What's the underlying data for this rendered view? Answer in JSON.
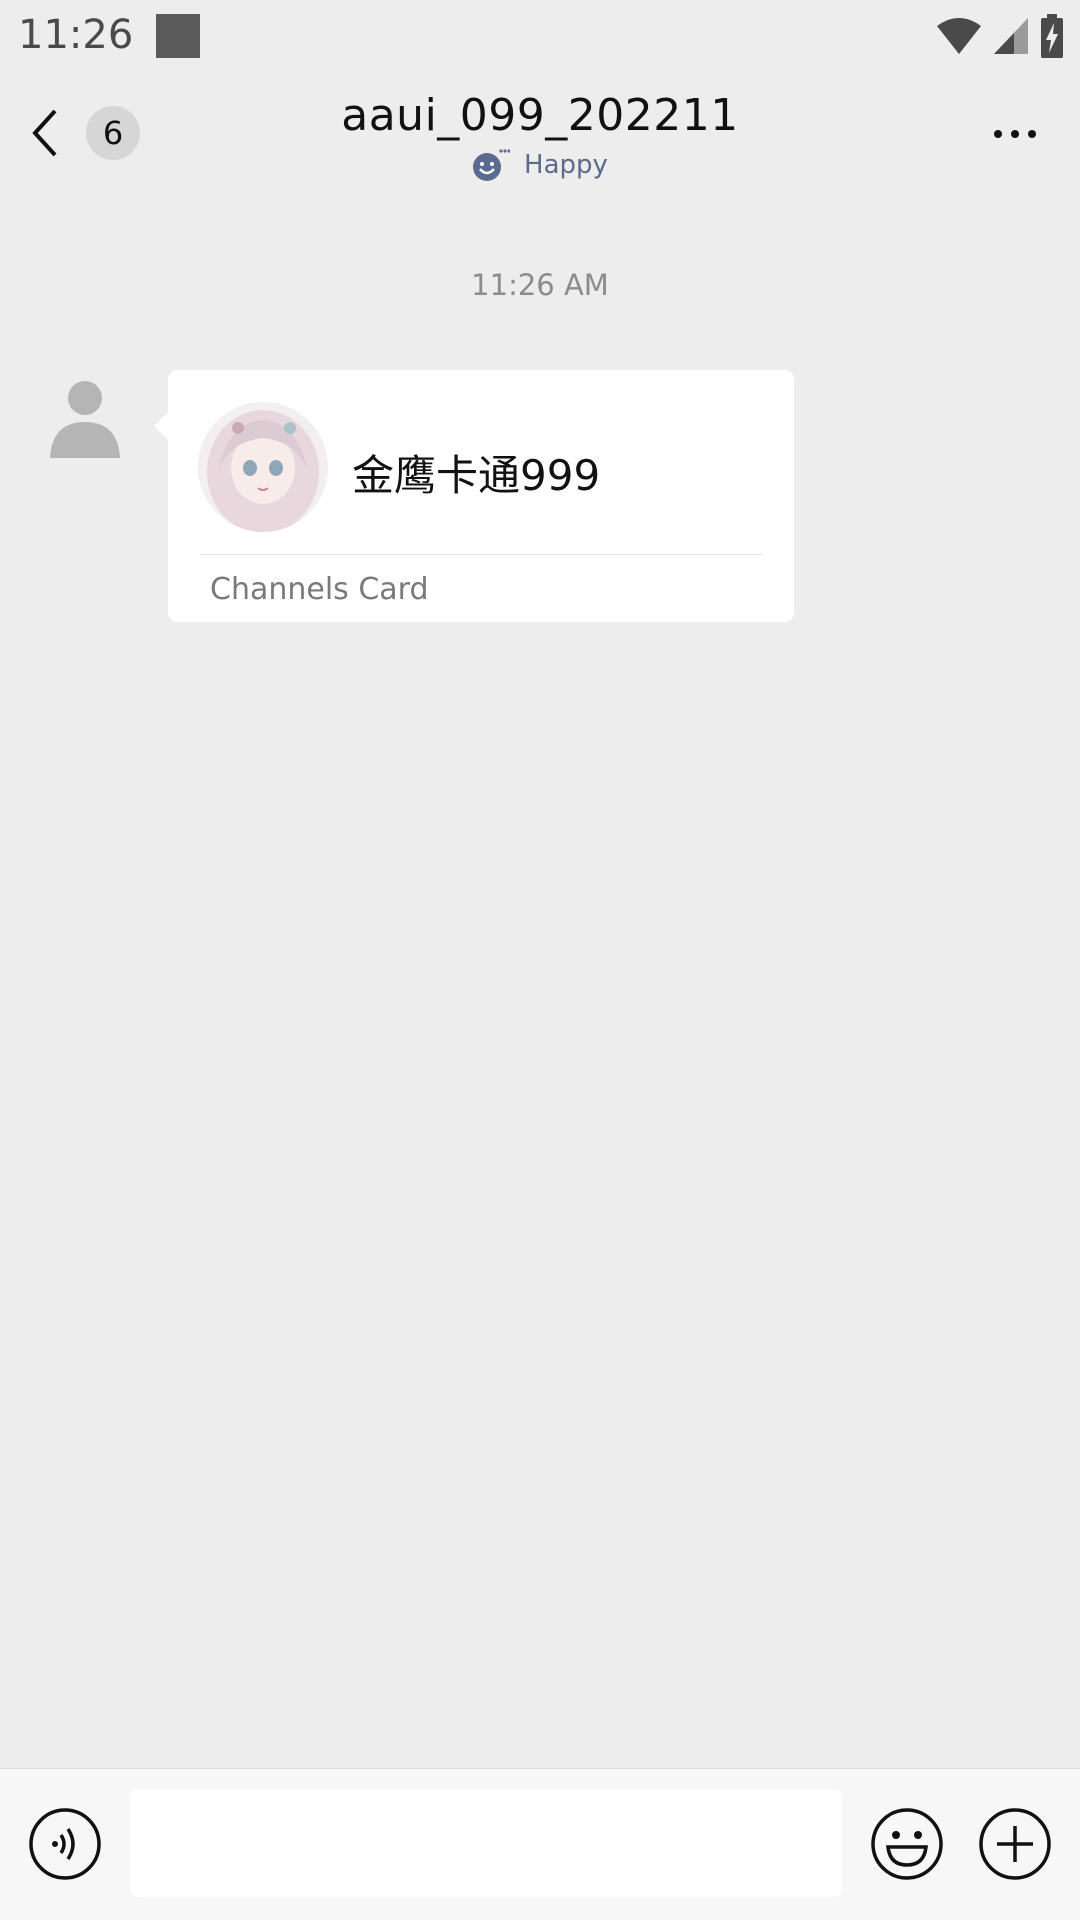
{
  "status_bar": {
    "time": "11:26",
    "icons": [
      "notification-square-icon",
      "wifi-icon",
      "signal-icon",
      "battery-charging-icon"
    ]
  },
  "header": {
    "unread_count": "6",
    "title": "aaui_099_202211",
    "status": "Happy",
    "icons": [
      "back-chevron-icon",
      "smiley-status-icon",
      "more-icon"
    ]
  },
  "chat": {
    "timestamp": "11:26 AM",
    "message": {
      "avatar_icon": "default-user-avatar-icon",
      "card": {
        "name": "金鹰卡通999",
        "type_label": "Channels Card",
        "avatar_image": "anime-girl-avatar"
      }
    }
  },
  "input_bar": {
    "text_value": "",
    "icons": [
      "voice-icon",
      "emoji-icon",
      "plus-icon"
    ]
  }
}
